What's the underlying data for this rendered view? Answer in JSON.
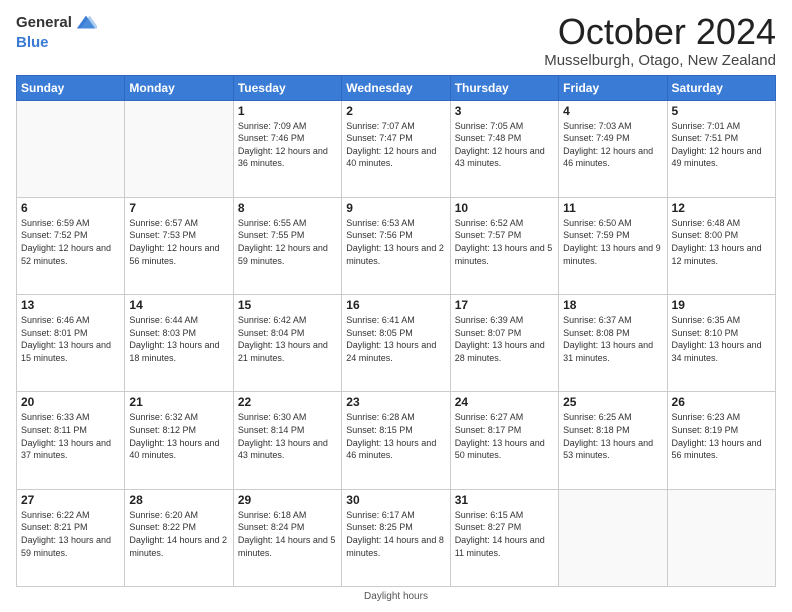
{
  "logo": {
    "general": "General",
    "blue": "Blue"
  },
  "title": "October 2024",
  "location": "Musselburgh, Otago, New Zealand",
  "days_of_week": [
    "Sunday",
    "Monday",
    "Tuesday",
    "Wednesday",
    "Thursday",
    "Friday",
    "Saturday"
  ],
  "footer": "Daylight hours",
  "weeks": [
    [
      {
        "day": null
      },
      {
        "day": null
      },
      {
        "day": "1",
        "sunrise": "Sunrise: 7:09 AM",
        "sunset": "Sunset: 7:46 PM",
        "daylight": "Daylight: 12 hours and 36 minutes."
      },
      {
        "day": "2",
        "sunrise": "Sunrise: 7:07 AM",
        "sunset": "Sunset: 7:47 PM",
        "daylight": "Daylight: 12 hours and 40 minutes."
      },
      {
        "day": "3",
        "sunrise": "Sunrise: 7:05 AM",
        "sunset": "Sunset: 7:48 PM",
        "daylight": "Daylight: 12 hours and 43 minutes."
      },
      {
        "day": "4",
        "sunrise": "Sunrise: 7:03 AM",
        "sunset": "Sunset: 7:49 PM",
        "daylight": "Daylight: 12 hours and 46 minutes."
      },
      {
        "day": "5",
        "sunrise": "Sunrise: 7:01 AM",
        "sunset": "Sunset: 7:51 PM",
        "daylight": "Daylight: 12 hours and 49 minutes."
      }
    ],
    [
      {
        "day": "6",
        "sunrise": "Sunrise: 6:59 AM",
        "sunset": "Sunset: 7:52 PM",
        "daylight": "Daylight: 12 hours and 52 minutes."
      },
      {
        "day": "7",
        "sunrise": "Sunrise: 6:57 AM",
        "sunset": "Sunset: 7:53 PM",
        "daylight": "Daylight: 12 hours and 56 minutes."
      },
      {
        "day": "8",
        "sunrise": "Sunrise: 6:55 AM",
        "sunset": "Sunset: 7:55 PM",
        "daylight": "Daylight: 12 hours and 59 minutes."
      },
      {
        "day": "9",
        "sunrise": "Sunrise: 6:53 AM",
        "sunset": "Sunset: 7:56 PM",
        "daylight": "Daylight: 13 hours and 2 minutes."
      },
      {
        "day": "10",
        "sunrise": "Sunrise: 6:52 AM",
        "sunset": "Sunset: 7:57 PM",
        "daylight": "Daylight: 13 hours and 5 minutes."
      },
      {
        "day": "11",
        "sunrise": "Sunrise: 6:50 AM",
        "sunset": "Sunset: 7:59 PM",
        "daylight": "Daylight: 13 hours and 9 minutes."
      },
      {
        "day": "12",
        "sunrise": "Sunrise: 6:48 AM",
        "sunset": "Sunset: 8:00 PM",
        "daylight": "Daylight: 13 hours and 12 minutes."
      }
    ],
    [
      {
        "day": "13",
        "sunrise": "Sunrise: 6:46 AM",
        "sunset": "Sunset: 8:01 PM",
        "daylight": "Daylight: 13 hours and 15 minutes."
      },
      {
        "day": "14",
        "sunrise": "Sunrise: 6:44 AM",
        "sunset": "Sunset: 8:03 PM",
        "daylight": "Daylight: 13 hours and 18 minutes."
      },
      {
        "day": "15",
        "sunrise": "Sunrise: 6:42 AM",
        "sunset": "Sunset: 8:04 PM",
        "daylight": "Daylight: 13 hours and 21 minutes."
      },
      {
        "day": "16",
        "sunrise": "Sunrise: 6:41 AM",
        "sunset": "Sunset: 8:05 PM",
        "daylight": "Daylight: 13 hours and 24 minutes."
      },
      {
        "day": "17",
        "sunrise": "Sunrise: 6:39 AM",
        "sunset": "Sunset: 8:07 PM",
        "daylight": "Daylight: 13 hours and 28 minutes."
      },
      {
        "day": "18",
        "sunrise": "Sunrise: 6:37 AM",
        "sunset": "Sunset: 8:08 PM",
        "daylight": "Daylight: 13 hours and 31 minutes."
      },
      {
        "day": "19",
        "sunrise": "Sunrise: 6:35 AM",
        "sunset": "Sunset: 8:10 PM",
        "daylight": "Daylight: 13 hours and 34 minutes."
      }
    ],
    [
      {
        "day": "20",
        "sunrise": "Sunrise: 6:33 AM",
        "sunset": "Sunset: 8:11 PM",
        "daylight": "Daylight: 13 hours and 37 minutes."
      },
      {
        "day": "21",
        "sunrise": "Sunrise: 6:32 AM",
        "sunset": "Sunset: 8:12 PM",
        "daylight": "Daylight: 13 hours and 40 minutes."
      },
      {
        "day": "22",
        "sunrise": "Sunrise: 6:30 AM",
        "sunset": "Sunset: 8:14 PM",
        "daylight": "Daylight: 13 hours and 43 minutes."
      },
      {
        "day": "23",
        "sunrise": "Sunrise: 6:28 AM",
        "sunset": "Sunset: 8:15 PM",
        "daylight": "Daylight: 13 hours and 46 minutes."
      },
      {
        "day": "24",
        "sunrise": "Sunrise: 6:27 AM",
        "sunset": "Sunset: 8:17 PM",
        "daylight": "Daylight: 13 hours and 50 minutes."
      },
      {
        "day": "25",
        "sunrise": "Sunrise: 6:25 AM",
        "sunset": "Sunset: 8:18 PM",
        "daylight": "Daylight: 13 hours and 53 minutes."
      },
      {
        "day": "26",
        "sunrise": "Sunrise: 6:23 AM",
        "sunset": "Sunset: 8:19 PM",
        "daylight": "Daylight: 13 hours and 56 minutes."
      }
    ],
    [
      {
        "day": "27",
        "sunrise": "Sunrise: 6:22 AM",
        "sunset": "Sunset: 8:21 PM",
        "daylight": "Daylight: 13 hours and 59 minutes."
      },
      {
        "day": "28",
        "sunrise": "Sunrise: 6:20 AM",
        "sunset": "Sunset: 8:22 PM",
        "daylight": "Daylight: 14 hours and 2 minutes."
      },
      {
        "day": "29",
        "sunrise": "Sunrise: 6:18 AM",
        "sunset": "Sunset: 8:24 PM",
        "daylight": "Daylight: 14 hours and 5 minutes."
      },
      {
        "day": "30",
        "sunrise": "Sunrise: 6:17 AM",
        "sunset": "Sunset: 8:25 PM",
        "daylight": "Daylight: 14 hours and 8 minutes."
      },
      {
        "day": "31",
        "sunrise": "Sunrise: 6:15 AM",
        "sunset": "Sunset: 8:27 PM",
        "daylight": "Daylight: 14 hours and 11 minutes."
      },
      {
        "day": null
      },
      {
        "day": null
      }
    ]
  ]
}
